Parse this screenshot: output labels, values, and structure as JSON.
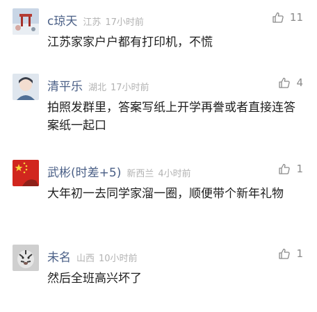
{
  "comments": [
    {
      "name": "c琼天",
      "location": "江苏",
      "time": "17小时前",
      "likes": "11",
      "text": "江苏家家户户都有打印机，不慌",
      "avatar_icon": "avatar-landscape-icon"
    },
    {
      "name": "清平乐",
      "location": "湖北",
      "time": "17小时前",
      "likes": "4",
      "text": "拍照发群里，答案写纸上开学再誊或者直接连答案纸一起口",
      "avatar_icon": "avatar-anime-boy-icon"
    },
    {
      "name": "武彬(时差+5)",
      "location": "新西兰",
      "time": "4小时前",
      "likes": "1",
      "text": "大年初一去同学家溜一圈，顺便带个新年礼物",
      "avatar_icon": "avatar-flag-icon"
    },
    {
      "name": "未名",
      "location": "山西",
      "time": "10小时前",
      "likes": "1",
      "text": "然后全班高兴坏了",
      "avatar_icon": "avatar-tiger-icon"
    }
  ]
}
